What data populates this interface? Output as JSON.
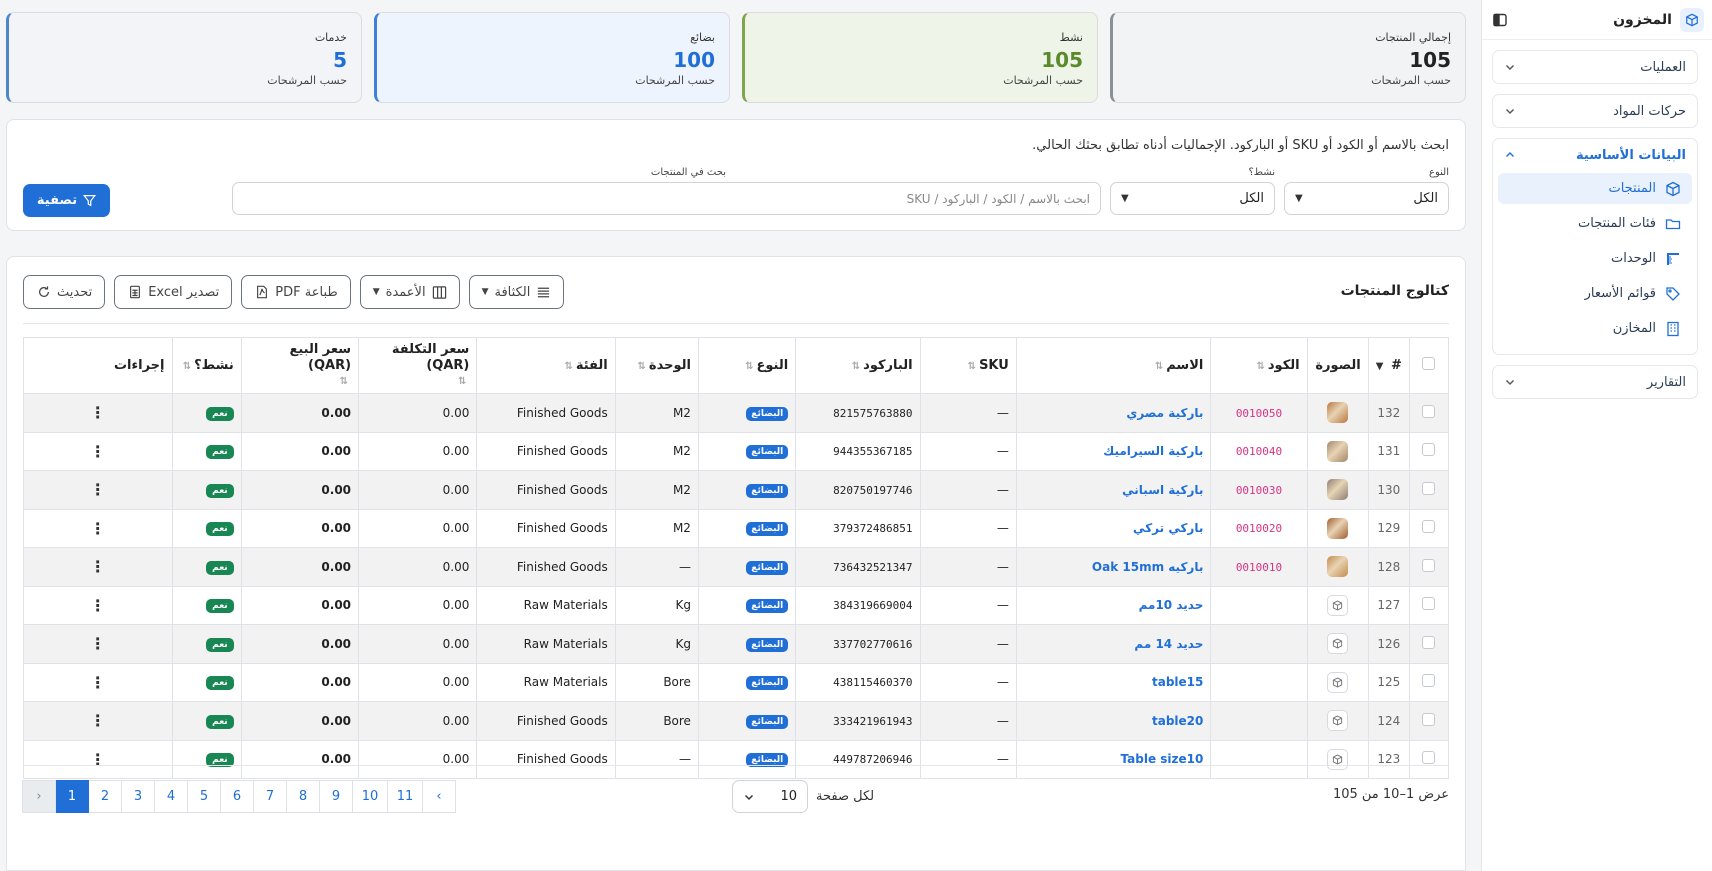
{
  "app": {
    "title": "المخزون"
  },
  "sidebar": {
    "groups": [
      {
        "label": "العمليات",
        "open": false
      },
      {
        "label": "حركات المواد",
        "open": false
      },
      {
        "label": "البيانات الأساسية",
        "open": true,
        "items": [
          {
            "label": "المنتجات",
            "icon": "box-icon",
            "active": true
          },
          {
            "label": "فئات المنتجات",
            "icon": "folder-icon"
          },
          {
            "label": "الوحدات",
            "icon": "ruler-icon"
          },
          {
            "label": "قوائم الأسعار",
            "icon": "tag-icon"
          },
          {
            "label": "المخازن",
            "icon": "building-icon"
          }
        ]
      },
      {
        "label": "التقارير",
        "open": false
      }
    ]
  },
  "cards": [
    {
      "label": "إجمالي المنتجات",
      "value": "105",
      "sub": "حسب المرشحات"
    },
    {
      "label": "نشط",
      "value": "105",
      "sub": "حسب المرشحات"
    },
    {
      "label": "بضائع",
      "value": "100",
      "sub": "حسب المرشحات"
    },
    {
      "label": "خدمات",
      "value": "5",
      "sub": "حسب المرشحات"
    }
  ],
  "filters": {
    "hint": "ابحث بالاسم أو الكود أو SKU أو الباركود. الإجماليات أدناه تطابق بحثك الحالي.",
    "type_label": "النوع",
    "type_value": "الكل",
    "active_label": "نشط؟",
    "active_value": "الكل",
    "search_label": "بحث في المنتجات",
    "search_placeholder": "ابحث بالاسم / الكود / الباركود / SKU",
    "filter_button": "تصفية"
  },
  "catalog": {
    "title": "كتالوج المنتجات",
    "toolbar": {
      "refresh": "تحديث",
      "excel": "تصدير Excel",
      "pdf": "طباعة PDF",
      "columns": "الأعمدة",
      "density": "الكثافة"
    },
    "columns": {
      "num": "#",
      "image": "الصورة",
      "code": "الكود",
      "name": "الاسم",
      "sku": "SKU",
      "barcode": "الباركود",
      "type": "النوع",
      "unit": "الوحدة",
      "category": "الفئة",
      "cost": "سعر التكلفة (QAR)",
      "price": "سعر البيع (QAR)",
      "active": "نشط؟",
      "actions": "إجراءات"
    },
    "rows": [
      {
        "num": "132",
        "image": "photo",
        "code": "0010050",
        "name": "باركية مصري",
        "sku": "—",
        "barcode": "821575763880",
        "type": "البضائع",
        "unit": "M2",
        "category": "Finished Goods",
        "cost": "0.00",
        "price": "0.00",
        "active": "نعم"
      },
      {
        "num": "131",
        "image": "photo",
        "code": "0010040",
        "name": "باركية السيراميك",
        "sku": "—",
        "barcode": "944355367185",
        "type": "البضائع",
        "unit": "M2",
        "category": "Finished Goods",
        "cost": "0.00",
        "price": "0.00",
        "active": "نعم"
      },
      {
        "num": "130",
        "image": "photo",
        "code": "0010030",
        "name": "باركية اسباني",
        "sku": "—",
        "barcode": "820750197746",
        "type": "البضائع",
        "unit": "M2",
        "category": "Finished Goods",
        "cost": "0.00",
        "price": "0.00",
        "active": "نعم"
      },
      {
        "num": "129",
        "image": "photo",
        "code": "0010020",
        "name": "باركي تركي",
        "sku": "—",
        "barcode": "379372486851",
        "type": "البضائع",
        "unit": "M2",
        "category": "Finished Goods",
        "cost": "0.00",
        "price": "0.00",
        "active": "نعم"
      },
      {
        "num": "128",
        "image": "photo",
        "code": "0010010",
        "name": "باركيه Oak 15mm",
        "sku": "—",
        "barcode": "736432521347",
        "type": "البضائع",
        "unit": "—",
        "category": "Finished Goods",
        "cost": "0.00",
        "price": "0.00",
        "active": "نعم"
      },
      {
        "num": "127",
        "image": "placeholder",
        "code": "",
        "name": "حديد 10مم",
        "sku": "—",
        "barcode": "384319669004",
        "type": "البضائع",
        "unit": "Kg",
        "category": "Raw Materials",
        "cost": "0.00",
        "price": "0.00",
        "active": "نعم"
      },
      {
        "num": "126",
        "image": "placeholder",
        "code": "",
        "name": "حديد 14 مم",
        "sku": "—",
        "barcode": "337702770616",
        "type": "البضائع",
        "unit": "Kg",
        "category": "Raw Materials",
        "cost": "0.00",
        "price": "0.00",
        "active": "نعم"
      },
      {
        "num": "125",
        "image": "placeholder",
        "code": "",
        "name": "table15",
        "sku": "—",
        "barcode": "438115460370",
        "type": "البضائع",
        "unit": "Bore",
        "category": "Raw Materials",
        "cost": "0.00",
        "price": "0.00",
        "active": "نعم"
      },
      {
        "num": "124",
        "image": "placeholder",
        "code": "",
        "name": "table20",
        "sku": "—",
        "barcode": "333421961943",
        "type": "البضائع",
        "unit": "Bore",
        "category": "Finished Goods",
        "cost": "0.00",
        "price": "0.00",
        "active": "نعم"
      },
      {
        "num": "123",
        "image": "placeholder",
        "code": "",
        "name": "Table size10",
        "sku": "—",
        "barcode": "449787206946",
        "type": "البضائع",
        "unit": "—",
        "category": "Finished Goods",
        "cost": "0.00",
        "price": "0.00",
        "active": "نعم"
      }
    ]
  },
  "pagination": {
    "info": "عرض 1–10 من 105",
    "per_page_label": "لكل صفحة",
    "per_page_value": "10",
    "prev": "‹",
    "next": "›",
    "pages": [
      "1",
      "2",
      "3",
      "4",
      "5",
      "6",
      "7",
      "8",
      "9",
      "10",
      "11"
    ],
    "current": "1"
  },
  "colors": {
    "primary": "#1f6fd6",
    "success": "#198754",
    "code": "#d63384"
  }
}
